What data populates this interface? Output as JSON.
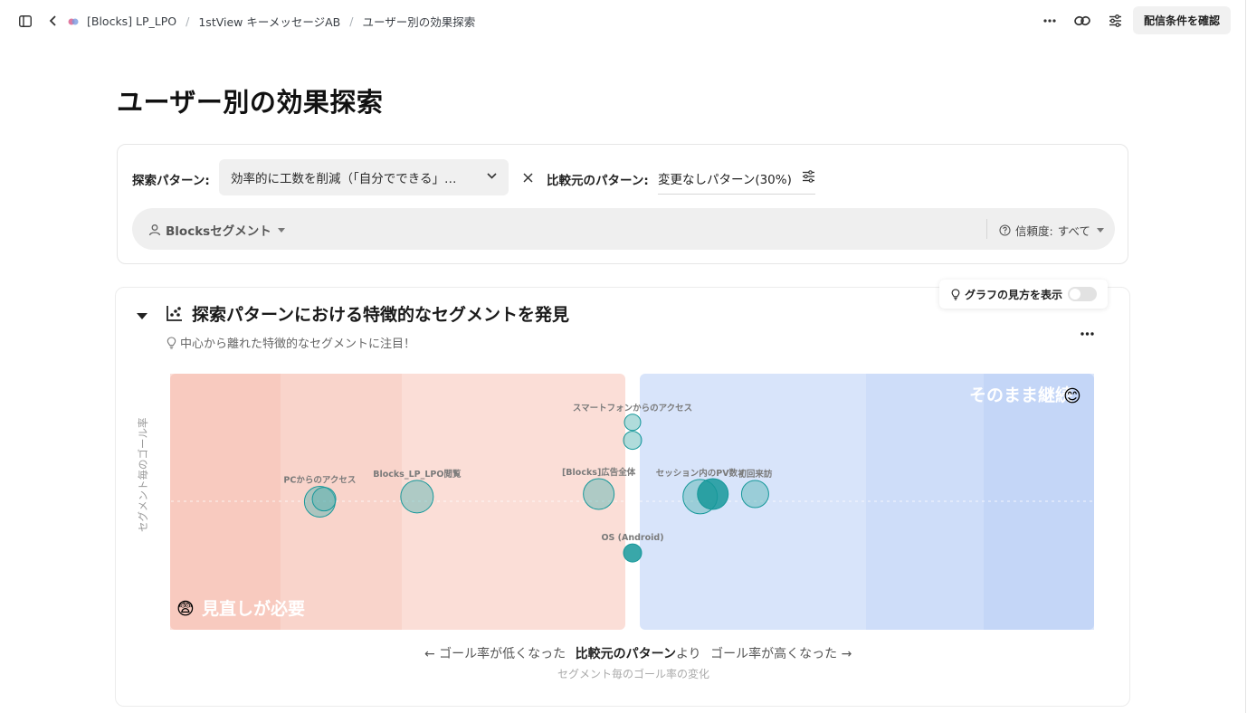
{
  "topbar": {
    "breadcrumb": [
      "[Blocks] LP_LPO",
      "1stView キーメッセージAB",
      "ユーザー別の効果探索"
    ],
    "confirm_button": "配信条件を確認",
    "icons": [
      "sidebar-toggle-icon",
      "back-chevron-icon",
      "more-icon",
      "link-icon",
      "settings-sliders-icon"
    ]
  },
  "page": {
    "title": "ユーザー別の効果探索"
  },
  "filters": {
    "pattern_label": "探索パターン:",
    "pattern_value": "効率的に工数を削減（「自分でできる」…",
    "base_label": "比較元のパターン:",
    "base_value": "変更なしパターン(30%)",
    "segment_label": "Blocksセグメント",
    "confidence_label": "信頼度:",
    "confidence_value": "すべて"
  },
  "section": {
    "title": "探索パターンにおける特徴的なセグメントを発見",
    "subtitle": "中心から離れた特徴的なセグメントに注目！",
    "guide_toggle_label": "グラフの見方を表示",
    "guide_toggle_on": false
  },
  "chart_data": {
    "type": "scatter",
    "ylabel": "セグメント毎のゴール率",
    "xlabel_left": "← ゴール率が低くなった",
    "xlabel_center": "比較元のパターン",
    "xlabel_connector": "より",
    "xlabel_right": "ゴール率が高くなった →",
    "xlabel": "セグメント毎のゴール率の変化",
    "region_left": "見直しが必要",
    "region_right": "そのまま継続",
    "region_left_emoji": "😨",
    "region_right_emoji": "😊",
    "colors": {
      "negative": "#f5a896",
      "positive": "#a8c4f5",
      "bubble": "#4fb1b0",
      "bubble_dark": "#16989a"
    },
    "x_range": [
      -1,
      1
    ],
    "y_range": [
      0,
      1
    ],
    "points": [
      {
        "label": "PCからのアクセス",
        "x": -0.74,
        "y": 0.5,
        "size": 17,
        "dark": false
      },
      {
        "label": "",
        "x": -0.73,
        "y": 0.51,
        "size": 13,
        "dark": false
      },
      {
        "label": "Blocks_LP_LPO閲覧",
        "x": -0.51,
        "y": 0.52,
        "size": 18,
        "dark": false
      },
      {
        "label": "[Blocks]広告全体",
        "x": -0.08,
        "y": 0.53,
        "size": 17,
        "dark": false
      },
      {
        "label": "スマートフォンからのアクセス",
        "x": 0.0,
        "y": 0.81,
        "size": 9,
        "dark": false
      },
      {
        "label": "",
        "x": 0.0,
        "y": 0.74,
        "size": 10,
        "dark": false
      },
      {
        "label": "セッション内のPV数 (",
        "x": 0.16,
        "y": 0.52,
        "size": 19,
        "dark": false
      },
      {
        "label": "",
        "x": 0.19,
        "y": 0.53,
        "size": 17,
        "dark": true
      },
      {
        "label": "初回来訪",
        "x": 0.29,
        "y": 0.53,
        "size": 15,
        "dark": false
      },
      {
        "label": "OS (Android)",
        "x": 0.0,
        "y": 0.3,
        "size": 10,
        "dark": true
      }
    ]
  }
}
